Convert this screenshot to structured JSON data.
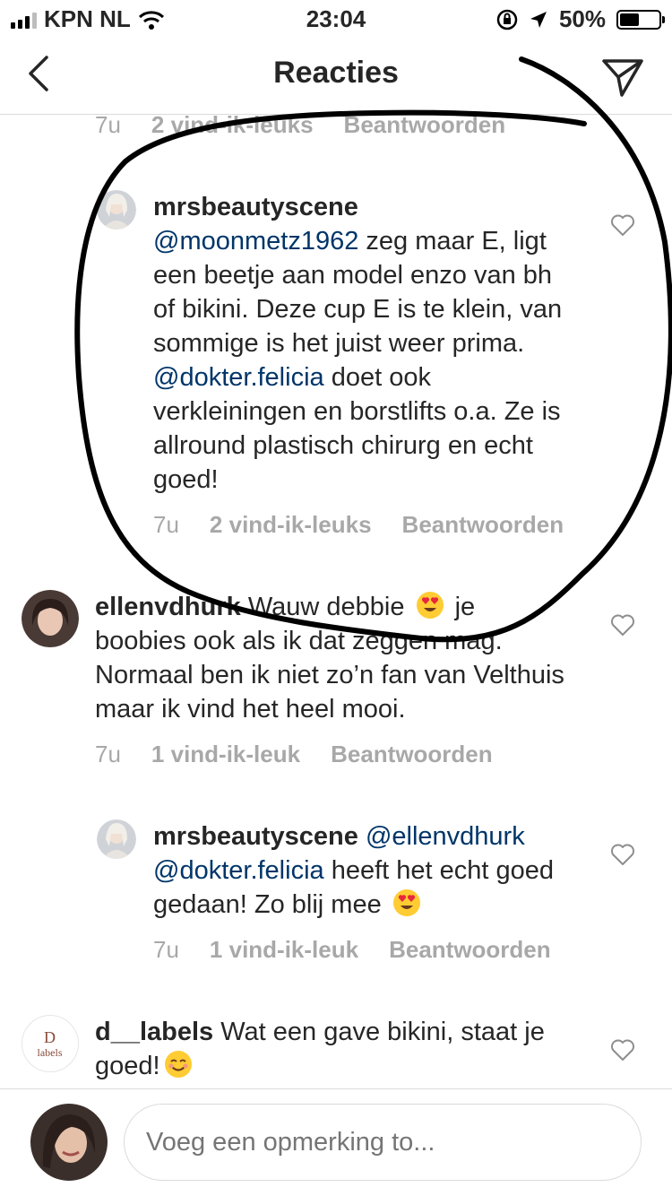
{
  "status": {
    "carrier": "KPN NL",
    "time": "23:04",
    "battery": "50%",
    "battery_level": 0.5
  },
  "nav": {
    "title": "Reacties"
  },
  "partial_meta": {
    "age": "7u",
    "likes": "2 vind-ik-leuks",
    "reply": "Beantwoorden"
  },
  "comments": [
    {
      "username": "mrsbeautyscene",
      "mention1": "@moonmetz1962",
      "text1": " zeg maar E, ligt een beetje aan model enzo van bh of bikini. Deze cup E is te klein, van sommige is het juist weer prima. ",
      "mention2": "@dokter.felicia",
      "text2": " doet ook verkleiningen en borstlifts o.a. Ze is allround plastisch chirurg en echt goed!",
      "age": "7u",
      "likes": "2 vind-ik-leuks",
      "reply": "Beantwoorden"
    },
    {
      "username": "ellenvdhurk",
      "text1": " Wauw debbie ",
      "text2": " je boobies ook als ik dat zeggen mag. Normaal ben ik niet zo’n fan van Velthuis maar ik vind het heel mooi.",
      "age": "7u",
      "likes": "1 vind-ik-leuk",
      "reply": "Beantwoorden"
    },
    {
      "username": "mrsbeautyscene",
      "mention1": " @ellenvdhurk",
      "mention2": "@dokter.felicia",
      "text1": " heeft het echt goed gedaan! Zo blij mee ",
      "age": "7u",
      "likes": "1 vind-ik-leuk",
      "reply": "Beantwoorden"
    },
    {
      "username": "d__labels",
      "text1": " Wat een gave bikini, staat je goed!",
      "logo_text": "labels"
    }
  ],
  "composer": {
    "placeholder": "Voeg een opmerking to..."
  },
  "colors": {
    "mention": "#003569",
    "meta": "#a8a8a8",
    "divider": "#dbdbdb",
    "text": "#262626"
  },
  "icons": [
    "back-icon",
    "send-icon",
    "heart-icon",
    "heart-eyes-emoji",
    "smiling-emoji",
    "wifi-icon",
    "lock-rotation-icon",
    "location-icon",
    "battery-icon"
  ]
}
